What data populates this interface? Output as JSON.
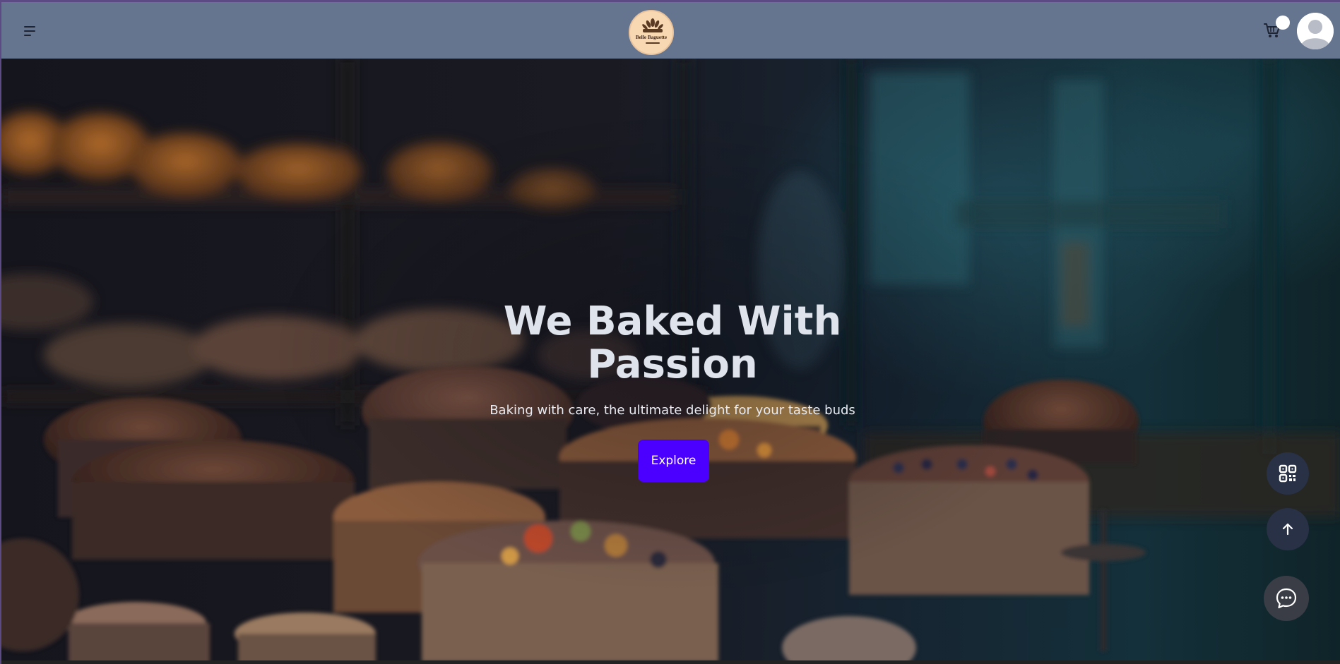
{
  "header": {
    "logo_text": "Belle Baguette",
    "menu_icon": "hamburger-menu-icon",
    "cart_icon": "cart-icon",
    "avatar_icon": "user-avatar-icon"
  },
  "hero": {
    "title_line1": "We Baked With",
    "title_line2": "Passion",
    "subtitle": "Baking with care, the ultimate delight for your taste buds",
    "cta_label": "Explore"
  },
  "floating_actions": {
    "qr_icon": "qr-code-icon",
    "scroll_top_icon": "arrow-up-icon",
    "chat_icon": "chat-bubble-icon"
  },
  "colors": {
    "header_bg": "#66758f",
    "cta_bg": "#4b00ff",
    "fab_bg": "#283145",
    "title_text": "#dfe3ec"
  }
}
